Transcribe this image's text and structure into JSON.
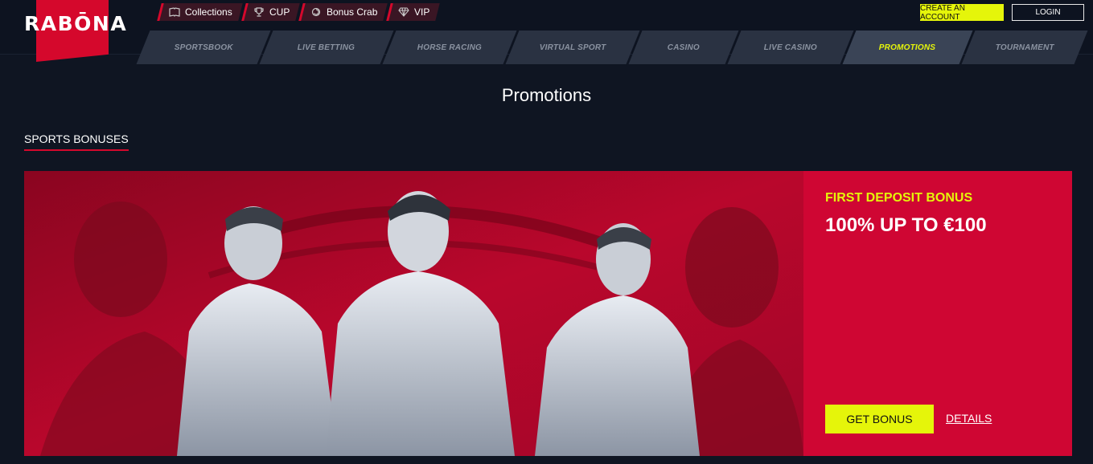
{
  "brand": {
    "logo_text": "RABŌNA"
  },
  "top_nav": [
    {
      "label": "Collections",
      "icon": "book-icon"
    },
    {
      "label": "CUP",
      "icon": "trophy-icon"
    },
    {
      "label": "Bonus Crab",
      "icon": "crab-icon"
    },
    {
      "label": "VIP",
      "icon": "diamond-icon"
    }
  ],
  "auth": {
    "create_account": "CREATE AN ACCOUNT",
    "login": "LOGIN"
  },
  "main_nav": [
    {
      "label": "SPORTSBOOK",
      "active": false
    },
    {
      "label": "LIVE BETTING",
      "active": false
    },
    {
      "label": "HORSE RACING",
      "active": false
    },
    {
      "label": "VIRTUAL SPORT",
      "active": false
    },
    {
      "label": "CASINO",
      "active": false
    },
    {
      "label": "LIVE CASINO",
      "active": false
    },
    {
      "label": "PROMOTIONS",
      "active": true
    },
    {
      "label": "TOURNAMENT",
      "active": false
    }
  ],
  "page": {
    "title": "Promotions",
    "section_title": "SPORTS BONUSES"
  },
  "promo": {
    "kicker": "FIRST DEPOSIT BONUS",
    "headline": "100% UP TO €100",
    "cta": "GET BONUS",
    "details_link": "DETAILS"
  },
  "colors": {
    "brand_red": "#d5082c",
    "accent_yellow": "#e5f50a",
    "background": "#0f1522",
    "panel_red": "#cf0633"
  }
}
